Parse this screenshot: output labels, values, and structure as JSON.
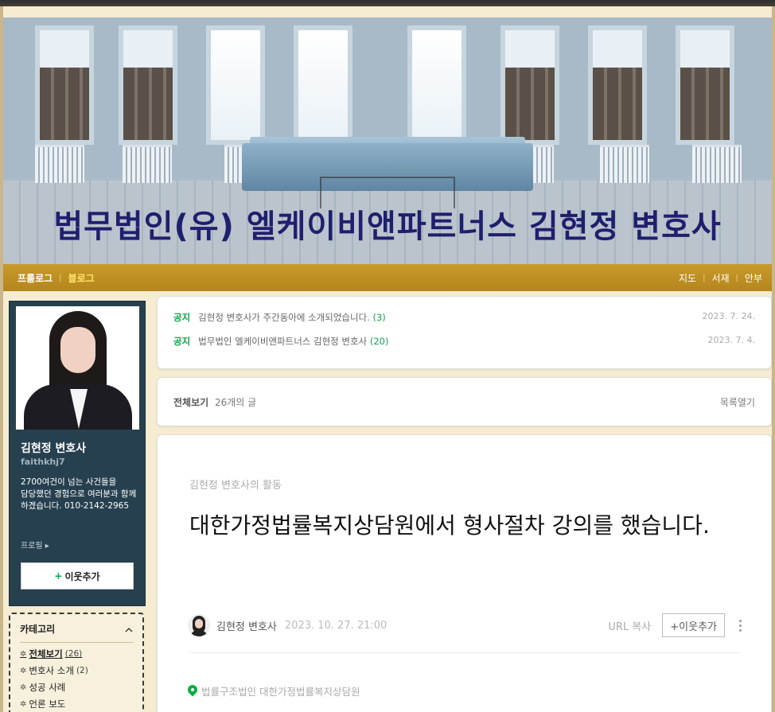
{
  "blog": {
    "title": "법무법인(유) 엘케이비앤파트너스 김현정 변호사"
  },
  "nav": {
    "left": [
      {
        "label": "프롤로그",
        "active": false
      },
      {
        "label": "블로그",
        "active": true
      }
    ],
    "right": [
      "지도",
      "서재",
      "안부"
    ]
  },
  "profile": {
    "name": "김현정 변호사",
    "id": "faithkhj7",
    "description": "2700여건이 넘는 사건들을 담당했던 경험으로 여러분과 함께 하겠습니다.          010-2142-2965",
    "profile_link": "프로필 ▸",
    "add_neighbor": "이웃추가",
    "add_plus": "+"
  },
  "category": {
    "title": "카테고리",
    "collapse_icon": "chevron-up",
    "items": [
      {
        "label": "전체보기",
        "count": "(26)",
        "strong": true
      },
      {
        "label": "변호사 소개",
        "count": "(2)",
        "strong": false
      },
      {
        "label": "성공 사례",
        "count": "",
        "strong": false
      },
      {
        "label": "언론 보도",
        "count": "",
        "strong": false
      }
    ]
  },
  "notices": [
    {
      "tag": "공지",
      "text": "김현정 변호사가 주간동아에 소개되었습니다.",
      "count": "(3)",
      "date": "2023. 7. 24."
    },
    {
      "tag": "공지",
      "text": "법무법인 엘케이비앤파트너스 김현정 변호사",
      "count": "(20)",
      "date": "2023. 7. 4."
    }
  ],
  "post_list": {
    "label": "전체보기",
    "count": "26개의 글",
    "toggle": "목록열기"
  },
  "post": {
    "category": "김현정 변호사의 활동",
    "title": "대한가정법률복지상담원에서 형사절차 강의를 했습니다.",
    "author": "김현정 변호사",
    "date": "2023. 10. 27. 21:00",
    "url_copy": "URL 복사",
    "add_neighbor": "+이웃추가",
    "place": "법률구조법인 대한가정법률복지상담원"
  },
  "colors": {
    "accent_green": "#11a24a",
    "nav_gold": "#c79a2c",
    "title_navy": "#1f1f6e",
    "profile_bg": "#26404f"
  }
}
